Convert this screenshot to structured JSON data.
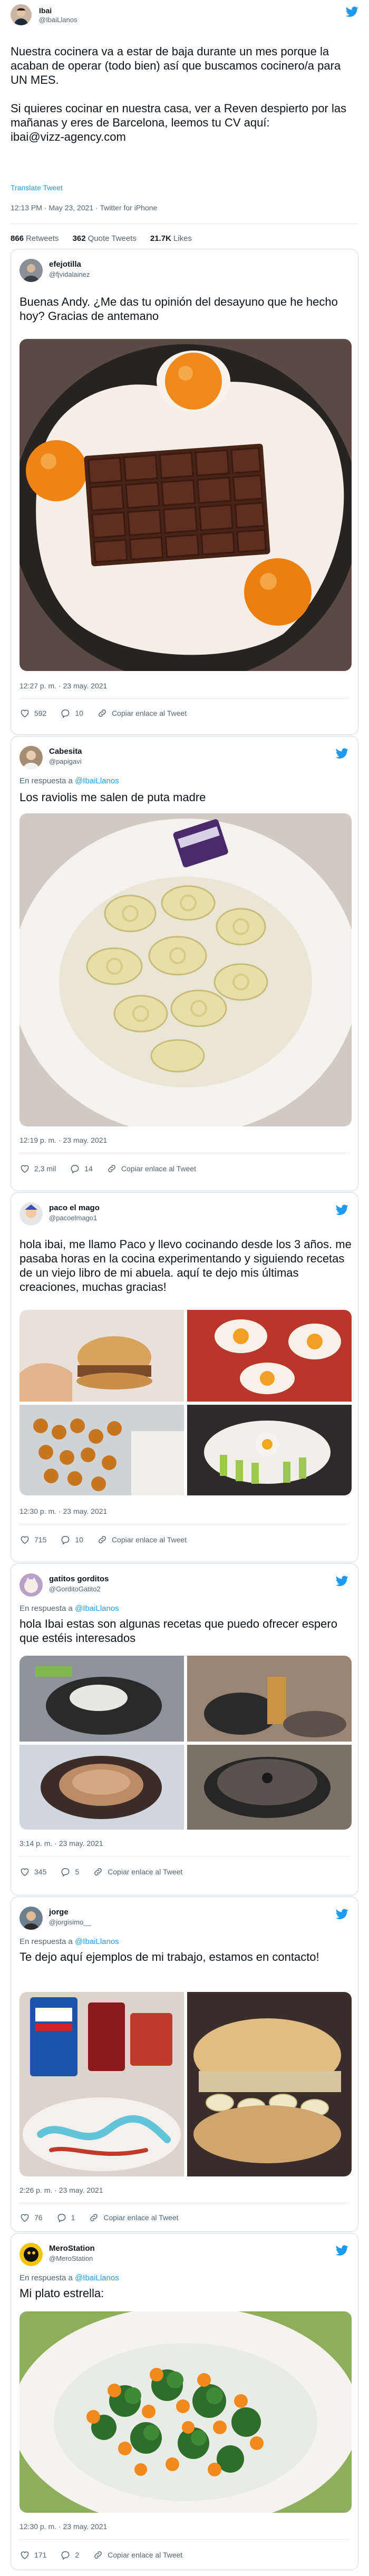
{
  "main_tweet": {
    "name": "Ibai",
    "handle": "@IbaiLlanos",
    "text": "Nuestra cocinera va a estar de baja durante un mes porque la acaban de operar (todo bien) así que buscamos cocinero/a para UN MES.\n\nSi quieres cocinar en nuestra casa, ver a Reven despierto por las mañanas y eres de Barcelona, leemos tu CV aquí:\nibai@vizz-agency.com",
    "translate": "Translate Tweet",
    "meta": "12:13 PM · May 23, 2021 · Twitter for iPhone",
    "retweets_count": "866",
    "retweets_label": "Retweets",
    "quotes_count": "362",
    "quotes_label": "Quote Tweets",
    "likes_count": "21.7K",
    "likes_label": "Likes"
  },
  "quotes": [
    {
      "name": "efejotilla",
      "handle": "@fjvidalainez",
      "reply_prefix": "",
      "reply_to": "",
      "text": "Buenas Andy. ¿Me das tu opinión del desayuno que he hecho hoy? Gracias de antemano",
      "time": "12:27 p. m. · 23 may. 2021",
      "likes": "592",
      "replies": "10",
      "copy": "Copiar enlace al Tweet",
      "media_icon": "eggs-chocolate-photo"
    },
    {
      "name": "Cabesita",
      "handle": "@papigavi",
      "reply_prefix": "En respuesta a ",
      "reply_to": "@IbaiLlanos",
      "text": "Los raviolis me salen de puta madre",
      "time": "12:19 p. m. · 23 may. 2021",
      "likes": "2,3 mil",
      "replies": "14",
      "copy": "Copiar enlace al Tweet",
      "media_icon": "condom-ravioli-photo"
    },
    {
      "name": "paco el mago",
      "handle": "@pacoelmago1",
      "reply_prefix": "",
      "reply_to": "",
      "text": "hola ibai, me llamo Paco y llevo cocinando desde los 3 años. me pasaba horas en la cocina experimentando y siguiendo recetas de un viejo libro de mi abuela. aquí te dejo mis últimas creaciones, muchas gracias!",
      "time": "12:30 p. m. · 23 may. 2021",
      "likes": "715",
      "replies": "10",
      "copy": "Copiar enlace al Tweet",
      "media_icon": "food-collage-photo"
    },
    {
      "name": "gatitos gorditos",
      "handle": "@GorditoGatito2",
      "reply_prefix": "En respuesta a ",
      "reply_to": "@IbaiLlanos",
      "text": "hola Ibai estas son algunas recetas que puedo ofrecer espero que estéis interesados",
      "time": "3:14 p. m. · 23 may. 2021",
      "likes": "345",
      "replies": "5",
      "copy": "Copiar enlace al Tweet",
      "media_icon": "kitchen-fails-collage"
    },
    {
      "name": "jorge",
      "handle": "@jorgisimo__",
      "reply_prefix": "En respuesta a ",
      "reply_to": "@IbaiLlanos",
      "text": "Te dejo aquí ejemplos de mi trabajo, estamos en contacto!",
      "time": "2:26 p. m. · 23 may. 2021",
      "likes": "76",
      "replies": "1",
      "copy": "Copiar enlace al Tweet",
      "media_icon": "toothpaste-sandwich-photo"
    },
    {
      "name": "MeroStation",
      "handle": "@MeroStation",
      "reply_prefix": "En respuesta a ",
      "reply_to": "@IbaiLlanos",
      "text": "Mi plato estrella:",
      "time": "12:30 p. m. · 23 may. 2021",
      "likes": "171",
      "replies": "2",
      "copy": "Copiar enlace al Tweet",
      "media_icon": "cheetos-broccoli-photo"
    }
  ],
  "colors": {
    "accent": "#1d9bf0",
    "muted": "#536471",
    "border": "#cfd9de"
  }
}
